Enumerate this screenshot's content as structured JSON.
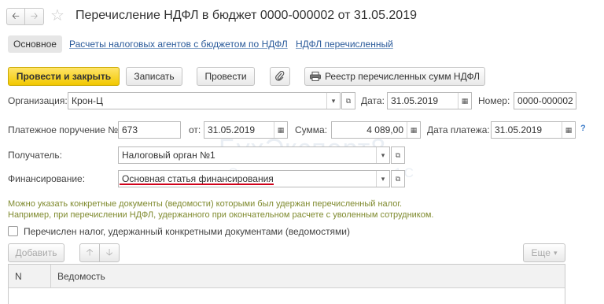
{
  "window": {
    "title": "Перечисление НДФЛ в бюджет 0000-000002 от 31.05.2019",
    "favorite_icon": "star-icon"
  },
  "tabs": {
    "active": "Основное",
    "links": [
      "Расчеты налоговых агентов с бюджетом по НДФЛ",
      "НДФЛ перечисленный"
    ]
  },
  "toolbar": {
    "post_close": "Провести и закрыть",
    "save": "Записать",
    "post": "Провести",
    "attach_icon": "paperclip-icon",
    "registry": "Реестр перечисленных сумм НДФЛ",
    "registry_icon": "printer-icon"
  },
  "form": {
    "org_label": "Организация:",
    "org_value": "Крон-Ц",
    "date_label": "Дата:",
    "date_value": "31.05.2019",
    "number_label": "Номер:",
    "number_value": "0000-000002",
    "payment_order_label": "Платежное поручение №:",
    "payment_order_value": "673",
    "from_label": "от:",
    "from_value": "31.05.2019",
    "sum_label": "Сумма:",
    "sum_value": "4 089,00",
    "pay_date_label": "Дата платежа:",
    "pay_date_value": "31.05.2019",
    "recipient_label": "Получатель:",
    "recipient_value": "Налоговый орган №1",
    "financing_label": "Финансирование:",
    "financing_value": "Основная статья финансирования",
    "help": "?"
  },
  "hint": {
    "line1": "Можно указать конкретные документы (ведомости) которыми был удержан перечисленный налог.",
    "line2": "Например, при перечислении НДФЛ, удержанного при окончательном расчете с уволенным сотрудником."
  },
  "checkbox": {
    "label": "Перечислен налог, удержанный конкретными документами (ведомостями)",
    "checked": false
  },
  "table": {
    "add_button": "Добавить",
    "more_button": "Еще",
    "columns": [
      "N",
      "Ведомость"
    ]
  },
  "watermark": {
    "main": "БухЭксперт8",
    "sub": "Ответов по учету в 1С"
  },
  "colors": {
    "accent_yellow": "#f2c800",
    "link_blue": "#2a5a9a",
    "underline_red": "#d0021b",
    "hint_olive": "#7f8a2e"
  }
}
